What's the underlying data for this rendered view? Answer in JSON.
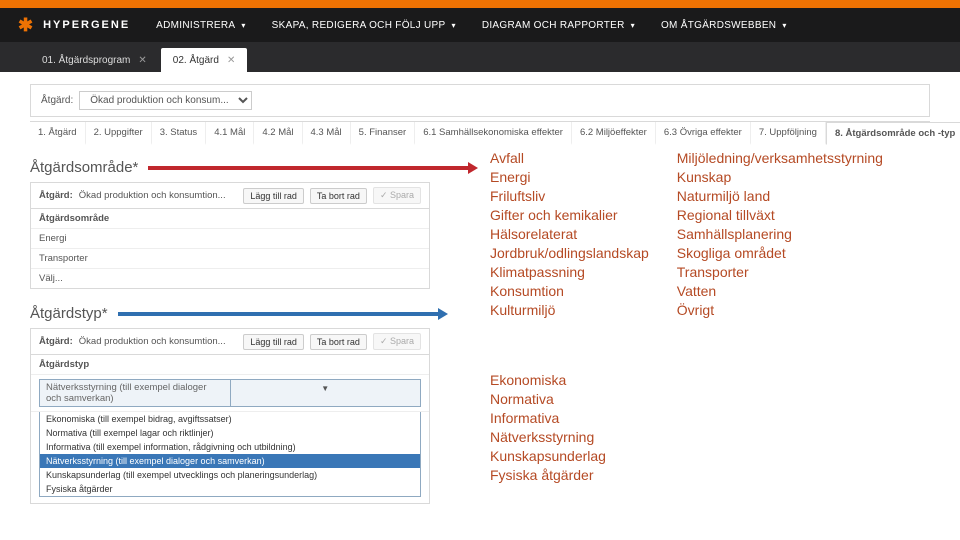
{
  "app": {
    "brand": "HYPERGENE"
  },
  "nav": {
    "items": [
      {
        "label": "ADMINISTRERA"
      },
      {
        "label": "SKAPA, REDIGERA OCH FÖLJ UPP"
      },
      {
        "label": "DIAGRAM OCH RAPPORTER"
      },
      {
        "label": "OM ÅTGÄRDSWEBBEN"
      }
    ]
  },
  "tabs": [
    {
      "label": "01. Åtgärdsprogram"
    },
    {
      "label": "02. Åtgärd"
    }
  ],
  "context": {
    "label": "Åtgärd:",
    "value": "Ökad produktion och konsum..."
  },
  "steps": [
    "1. Åtgärd",
    "2. Uppgifter",
    "3. Status",
    "4.1 Mål",
    "4.2 Mål",
    "4.3 Mål",
    "5. Finanser",
    "6.1 Samhällsekonomiska effekter",
    "6.2 Miljöeffekter",
    "6.3 Övriga effekter",
    "7. Uppföljning",
    "8. Åtgärdsområde och -typ"
  ],
  "sectionA": {
    "title": "Åtgärdsområde*",
    "panel": {
      "label": "Åtgärd:",
      "value": "Ökad produktion och konsumtion...",
      "btn1": "Lägg till rad",
      "btn2": "Ta bort rad",
      "btn3": "✓ Spara",
      "row_header": "Åtgärdsområde",
      "rows": [
        "Energi",
        "Transporter",
        "Välj..."
      ]
    }
  },
  "sectionB": {
    "title": "Åtgärdstyp*",
    "panel": {
      "label": "Åtgärd:",
      "value": "Ökad produktion och konsumtion...",
      "btn1": "Lägg till rad",
      "btn2": "Ta bort rad",
      "btn3": "✓ Spara",
      "row_header": "Åtgärdstyp",
      "dropdown_label": "Nätverksstyrning (till exempel dialoger och samverkan)",
      "options": [
        "Ekonomiska (till exempel bidrag, avgiftssatser)",
        "Normativa (till exempel lagar och riktlinjer)",
        "Informativa (till exempel information, rådgivning och utbildning)",
        "Nätverksstyrning (till exempel dialoger och samverkan)",
        "Kunskapsunderlag (till exempel utvecklings och planeringsunderlag)",
        "Fysiska åtgärder"
      ]
    }
  },
  "catsA_left": [
    "Avfall",
    "Energi",
    "Friluftsliv",
    "Gifter och kemikalier",
    "Hälsorelaterat",
    "Jordbruk/odlingslandskap",
    "Klimatpassning",
    "Konsumtion",
    "Kulturmiljö"
  ],
  "catsA_right": [
    "Miljöledning/verksamhetsstyrning",
    "Kunskap",
    "Naturmiljö land",
    "Regional tillväxt",
    "Samhällsplanering",
    "Skogliga området",
    "Transporter",
    "Vatten",
    "Övrigt"
  ],
  "catsB": [
    "Ekonomiska",
    "Normativa",
    "Informativa",
    "Nätverksstyrning",
    "Kunskapsunderlag",
    "Fysiska åtgärder"
  ]
}
